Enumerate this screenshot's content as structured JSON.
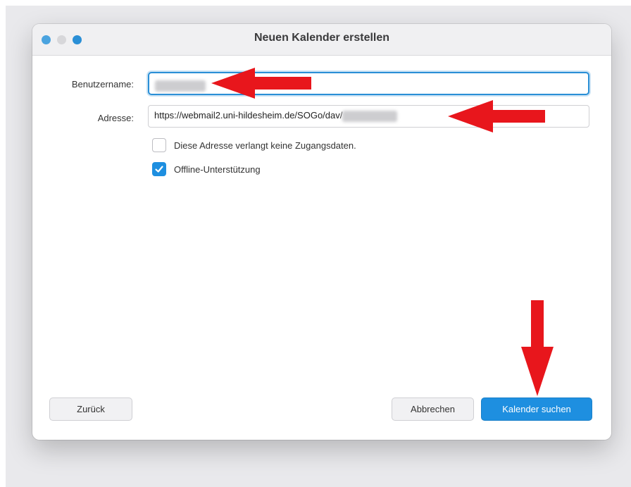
{
  "window": {
    "title": "Neuen Kalender erstellen",
    "traffic_colors": {
      "close": "#4aa3df",
      "minimize": "#d7d7da",
      "maximize": "#2a8fd6"
    }
  },
  "form": {
    "username_label": "Benutzername:",
    "username_value": "",
    "address_label": "Adresse:",
    "address_value": "https://webmail2.uni-hildesheim.de/SOGo/dav/"
  },
  "options": [
    {
      "label": "Diese Adresse verlangt keine Zugangsdaten.",
      "checked": false
    },
    {
      "label": "Offline-Unterstützung",
      "checked": true
    }
  ],
  "buttons": {
    "back": "Zurück",
    "cancel": "Abbrechen",
    "search": "Kalender suchen"
  },
  "colors": {
    "accent": "#1e8fe0",
    "annotation_arrow": "#e8161c"
  },
  "icons": {
    "checkmark": "checkmark-icon",
    "annotation": "red-arrow-icon"
  }
}
